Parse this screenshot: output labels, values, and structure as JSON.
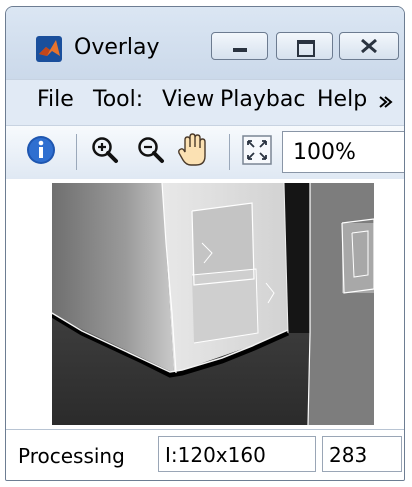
{
  "window": {
    "title": "Overlay",
    "icon": "matlab-logo-icon"
  },
  "menu": {
    "items": [
      "File",
      "Tool:",
      "View",
      "Playbac",
      "Help"
    ]
  },
  "toolbar": {
    "zoom_value": "100%"
  },
  "status": {
    "state": "Processing",
    "dimensions": "I:120x160",
    "frame": "283"
  }
}
